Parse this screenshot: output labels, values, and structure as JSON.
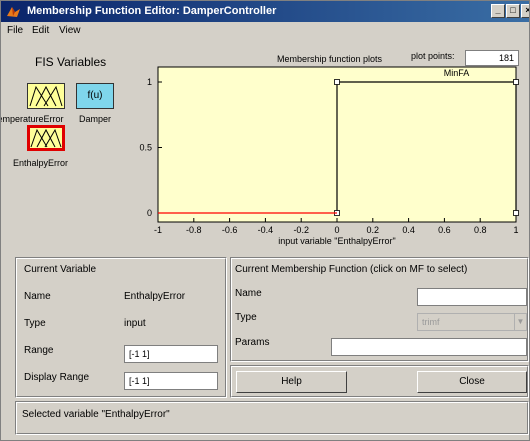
{
  "window": {
    "title": "Membership Function Editor: DamperController",
    "minimize": "_",
    "maximize": "□",
    "close": "×"
  },
  "menu": [
    "File",
    "Edit",
    "View"
  ],
  "fis_variables": {
    "heading": "FIS Variables",
    "inputs": [
      "TemperatureError",
      "EnthalpyError"
    ],
    "output_label": "Damper",
    "output_box_text": "f(u)",
    "selected": "EnthalpyError",
    "input_color": "#ffff99",
    "output_color": "#7fd6ec",
    "selected_border": "#e00000"
  },
  "plot": {
    "title": "Membership function plots",
    "plot_points_label": "plot points:",
    "plot_points_value": "181"
  },
  "chart_data": {
    "type": "line",
    "xlabel": "input variable \"EnthalpyError\"",
    "ylabel": "",
    "xlim": [
      -1,
      1
    ],
    "ylim": [
      0,
      1
    ],
    "xticks": [
      "-1",
      "-0.8",
      "-0.6",
      "-0.4",
      "-0.2",
      "0",
      "0.2",
      "0.4",
      "0.6",
      "0.8",
      "1"
    ],
    "yticks": [
      "0",
      "0.5",
      "1"
    ],
    "background": "#ffffcc",
    "series": [
      {
        "name": "MinFA",
        "color": "#000000",
        "points": [
          [
            0,
            0
          ],
          [
            0,
            1
          ],
          [
            1,
            1
          ],
          [
            1,
            0
          ]
        ]
      },
      {
        "name": "",
        "color": "#ff0000",
        "points": [
          [
            -1,
            0
          ],
          [
            0,
            0
          ]
        ]
      }
    ]
  },
  "current_variable": {
    "heading": "Current Variable",
    "name_label": "Name",
    "name_value": "EnthalpyError",
    "type_label": "Type",
    "type_value": "input",
    "range_label": "Range",
    "range_value": "[-1 1]",
    "display_range_label": "Display Range",
    "display_range_value": "[-1 1]"
  },
  "current_mf": {
    "heading": "Current Membership Function (click on MF to select)",
    "name_label": "Name",
    "name_value": "",
    "type_label": "Type",
    "type_value": "trimf",
    "params_label": "Params",
    "params_value": ""
  },
  "buttons": {
    "help": "Help",
    "close": "Close"
  },
  "status": "Selected variable \"EnthalpyError\""
}
